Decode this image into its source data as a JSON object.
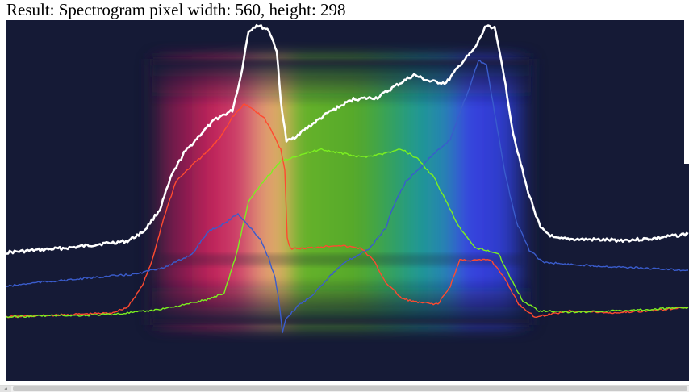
{
  "result": {
    "text": "Result: Spectrogram pixel width: 560, height: 298"
  },
  "spectrogram": {
    "background_color": "#151a36",
    "band_colors": [
      "#d0245e",
      "#f2a07a",
      "#5ab52a",
      "#21a59a",
      "#3c46f0"
    ],
    "traces": [
      {
        "name": "white",
        "color": "#ffffff"
      },
      {
        "name": "red",
        "color": "#ff4a30"
      },
      {
        "name": "green",
        "color": "#7cf020"
      },
      {
        "name": "blue",
        "color": "#3a5ccc"
      }
    ]
  },
  "scrollbar": {
    "left_arrow": "◂"
  }
}
